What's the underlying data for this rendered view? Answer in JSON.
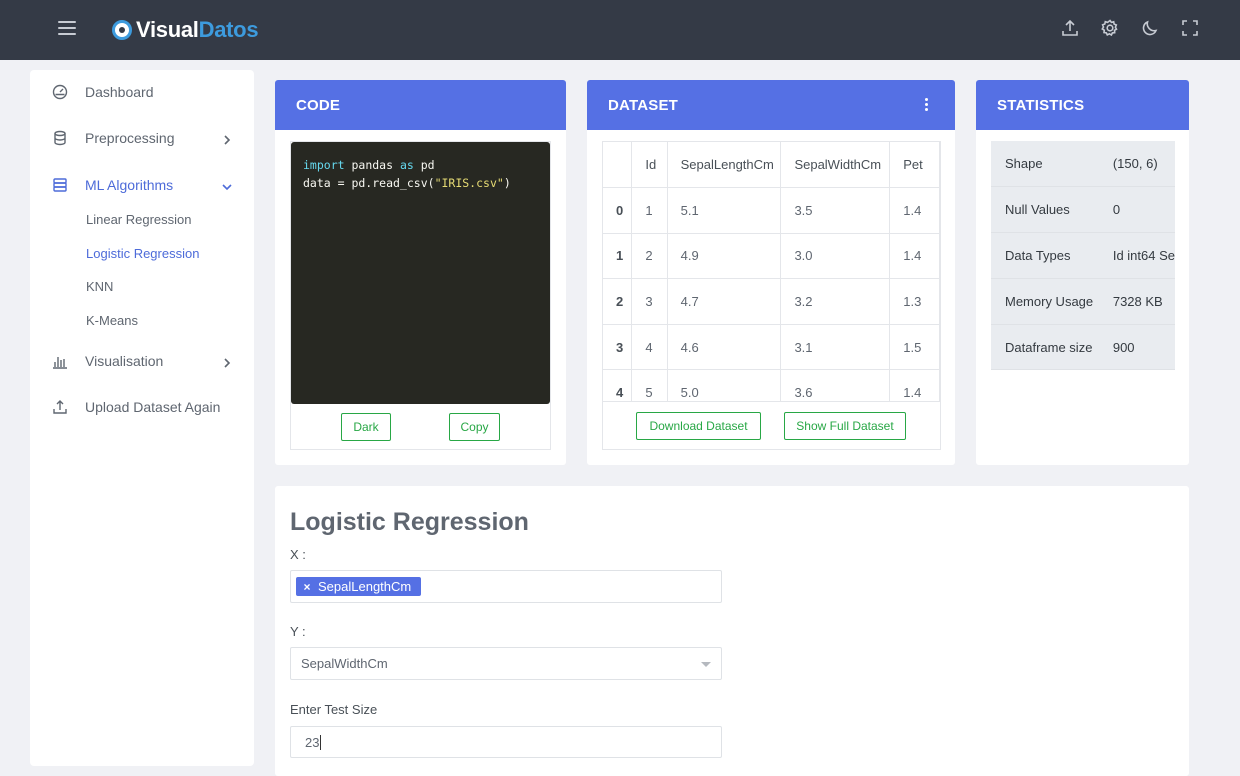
{
  "brand": {
    "part1": "Visual",
    "part2": "Datos"
  },
  "topbar": {
    "icons": [
      "upload-icon",
      "gear-icon",
      "moon-icon",
      "fullscreen-icon"
    ]
  },
  "sidebar": {
    "items": [
      {
        "label": "Dashboard",
        "icon": "dashboard-icon"
      },
      {
        "label": "Preprocessing",
        "icon": "database-icon"
      },
      {
        "label": "ML Algorithms",
        "icon": "server-icon"
      },
      {
        "label": "Visualisation",
        "icon": "bar-chart-icon"
      },
      {
        "label": "Upload Dataset Again",
        "icon": "upload-icon"
      }
    ],
    "subitems": [
      "Linear Regression",
      "Logistic Regression",
      "KNN",
      "K-Means"
    ],
    "active_subitem": "Logistic Regression"
  },
  "code_card": {
    "title": "CODE",
    "line1": {
      "kw1": "import",
      "mid": " pandas ",
      "kw2": "as",
      "end": " pd"
    },
    "line2": {
      "start": "data = pd.read_csv(",
      "str": "\"IRIS.csv\"",
      "end": ")"
    },
    "dark_label": "Dark",
    "copy_label": "Copy"
  },
  "dataset_card": {
    "title": "DATASET",
    "columns": [
      "",
      "Id",
      "SepalLengthCm",
      "SepalWidthCm",
      "Pet"
    ],
    "rows": [
      [
        "0",
        "1",
        "5.1",
        "3.5",
        "1.4"
      ],
      [
        "1",
        "2",
        "4.9",
        "3.0",
        "1.4"
      ],
      [
        "2",
        "3",
        "4.7",
        "3.2",
        "1.3"
      ],
      [
        "3",
        "4",
        "4.6",
        "3.1",
        "1.5"
      ],
      [
        "4",
        "5",
        "5.0",
        "3.6",
        "1.4"
      ]
    ],
    "download_label": "Download Dataset",
    "show_full_label": "Show Full Dataset"
  },
  "stats_card": {
    "title": "STATISTICS",
    "rows": [
      {
        "key": "Shape",
        "value": "(150, 6)"
      },
      {
        "key": "Null Values",
        "value": "0"
      },
      {
        "key": "Data Types",
        "value": "Id int64 Se"
      },
      {
        "key": "Memory Usage",
        "value": "7328 KB"
      },
      {
        "key": "Dataframe size",
        "value": "900"
      }
    ]
  },
  "form": {
    "title": "Logistic Regression",
    "x_label": "X :",
    "x_chip_remove": "×",
    "x_chip": "SepalLengthCm",
    "y_label": "Y :",
    "y_value": "SepalWidthCm",
    "test_label": "Enter Test Size",
    "test_value": "23"
  },
  "colors": {
    "topbar": "#343a46",
    "accent": "#5570e4",
    "brand_blue": "#3d9bde",
    "success": "#28a745"
  }
}
